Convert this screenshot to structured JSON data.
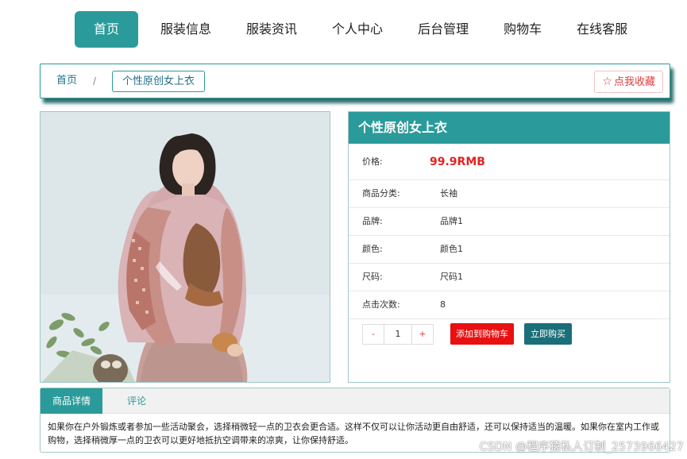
{
  "nav": {
    "items": [
      "首页",
      "服装信息",
      "服装资讯",
      "个人中心",
      "后台管理",
      "购物车",
      "在线客服"
    ],
    "active_index": 0
  },
  "breadcrumb": {
    "home": "首页",
    "separator": "/",
    "current": "个性原创女上衣"
  },
  "favorite": {
    "icon": "star-outline-icon",
    "label": "点我收藏"
  },
  "product": {
    "image_alt": "product-photo-woman-pink-hoodie",
    "title": "个性原创女上衣",
    "price_label": "价格:",
    "price": "99.9RMB",
    "attributes": [
      {
        "key": "商品分类:",
        "value": "长袖"
      },
      {
        "key": "品牌:",
        "value": "品牌1"
      },
      {
        "key": "颜色:",
        "value": "颜色1"
      },
      {
        "key": "尺码:",
        "value": "尺码1"
      },
      {
        "key": "点击次数:",
        "value": "8"
      }
    ],
    "quantity": {
      "minus": "-",
      "value": "1",
      "plus": "+"
    },
    "add_to_cart": "添加到购物车",
    "buy_now": "立即购买"
  },
  "detail": {
    "tabs": [
      "商品详情",
      "评论"
    ],
    "active_tab": 0,
    "description": "如果你在户外锻炼或者参加一些活动聚会，选择稍微轻一点的卫衣会更合适。这样不仅可以让你活动更自由舒适，还可以保持适当的温暖。如果你在室内工作或购物，选择稍微厚一点的卫衣可以更好地抵抗空调带来的凉爽，让你保持舒适。"
  },
  "watermark": "CSDN @程序猿私人订制_2573966427",
  "colors": {
    "accent": "#2a9b9a",
    "price": "#e22222",
    "add_cart": "#e81010",
    "buy_now": "#1b6f79"
  }
}
